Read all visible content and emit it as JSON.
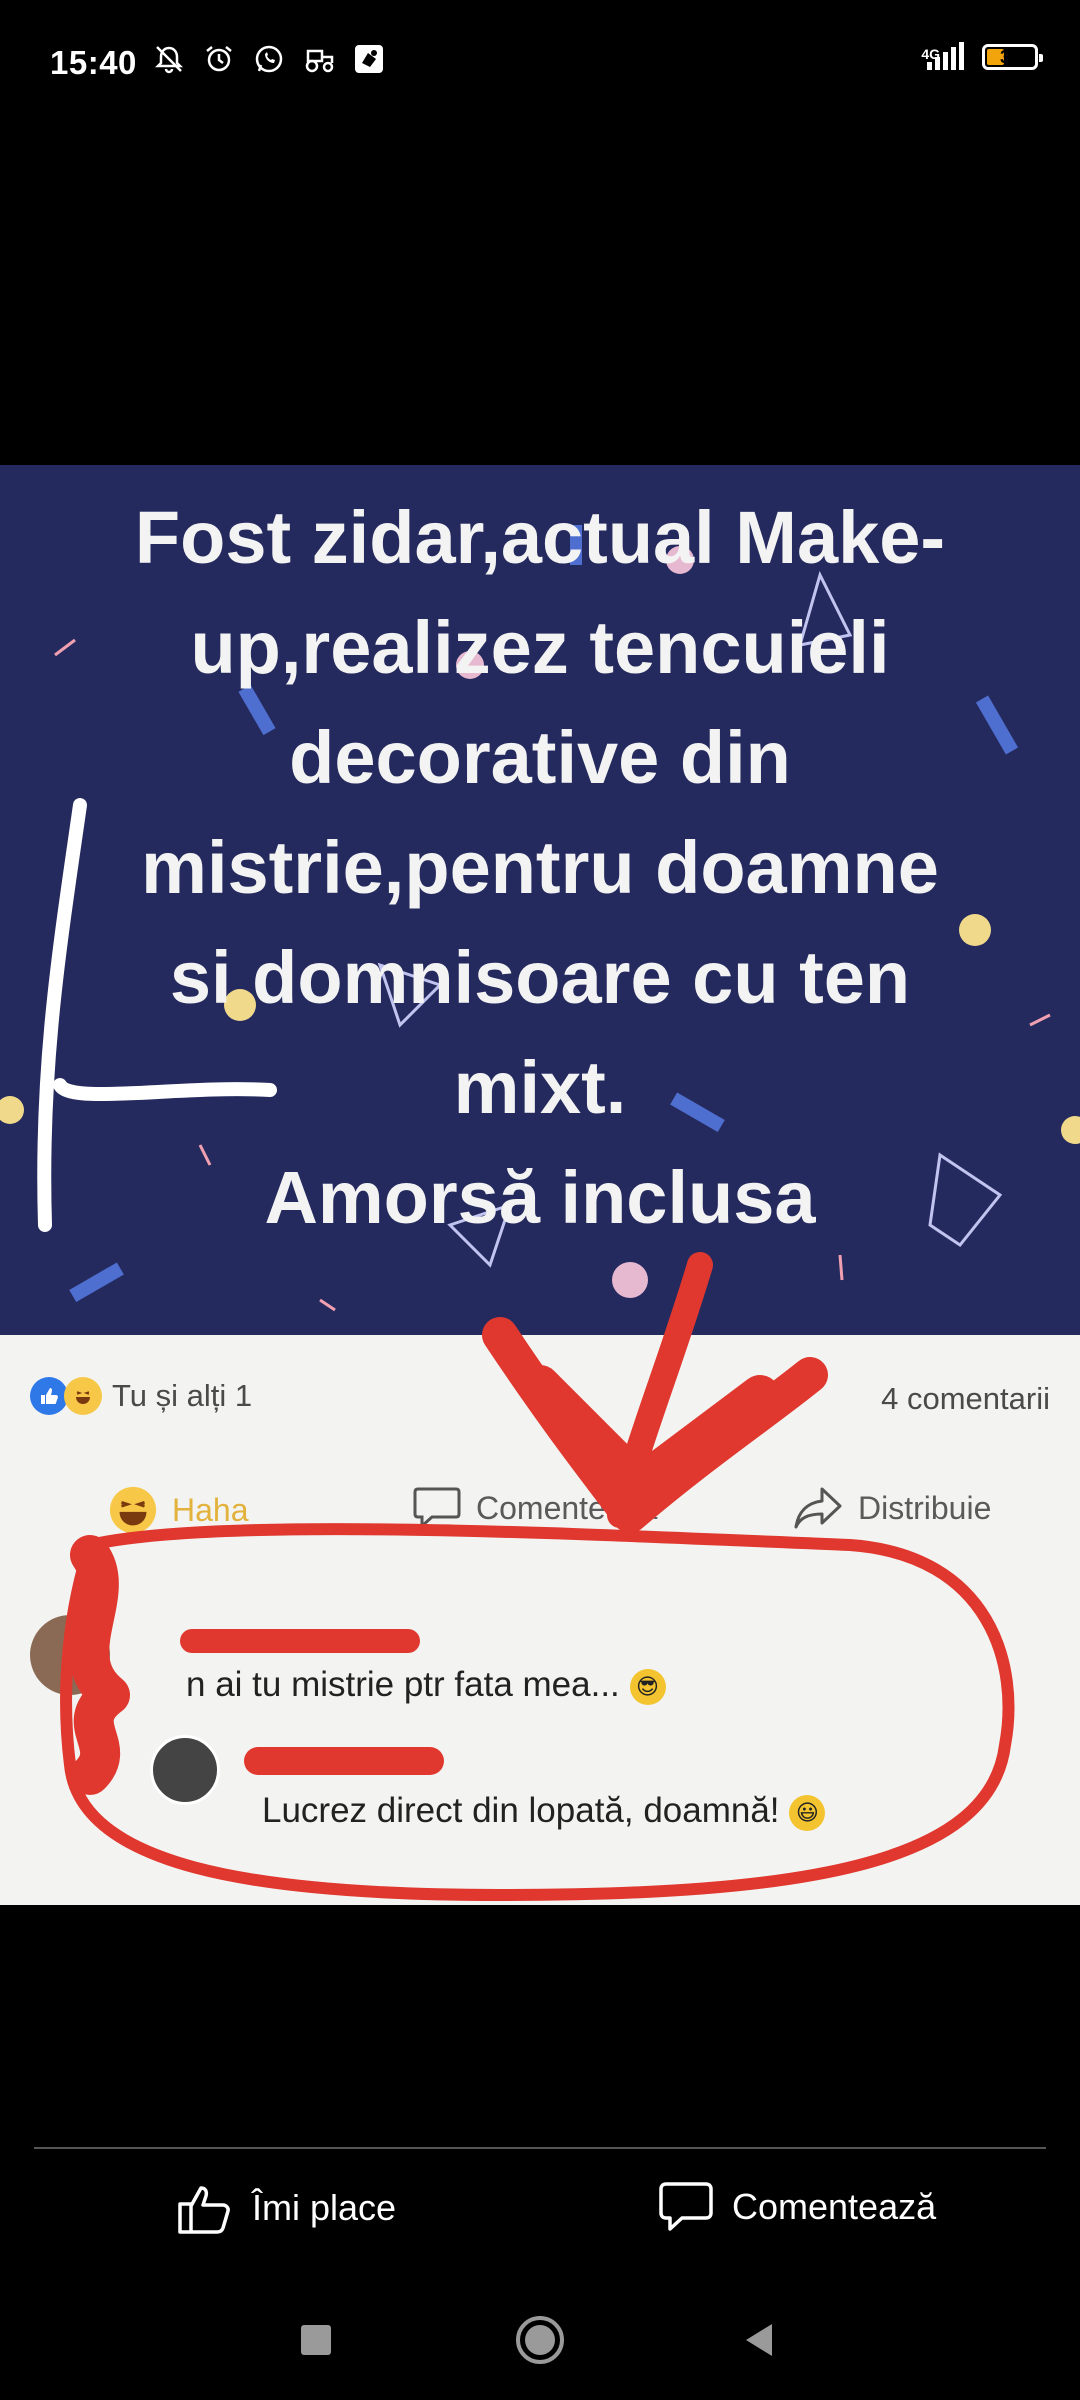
{
  "status_bar": {
    "time": "15:40",
    "network": "4G",
    "battery": "38",
    "battery_level": 0.38,
    "icons": [
      "notifications-off-icon",
      "alarm-icon",
      "whatsapp-icon",
      "tractor-icon",
      "app-icon"
    ]
  },
  "meme": {
    "lines": [
      "Fost zidar,actual Make-",
      "up,realizez tencuieli",
      "decorative din",
      "mistrie,pentru doamne",
      "si domnisoare cu ten",
      "mixt.",
      "Amorsă inclusa"
    ],
    "colors": {
      "background": "#252a5e",
      "annotation": "#e0382f"
    }
  },
  "facebook_post": {
    "reactions_label": "Tu și alți 1",
    "comments_count": "4 comentarii",
    "actions": {
      "haha": "Haha",
      "comment": "Comentează",
      "share": "Distribuie"
    },
    "comments": [
      {
        "text": "n ai tu mistrie ptr fata mea..."
      },
      {
        "text": "Lucrez direct din lopată, doamnă!"
      }
    ]
  },
  "viewer_actions": {
    "like": "Îmi place",
    "comment": "Comentează"
  }
}
